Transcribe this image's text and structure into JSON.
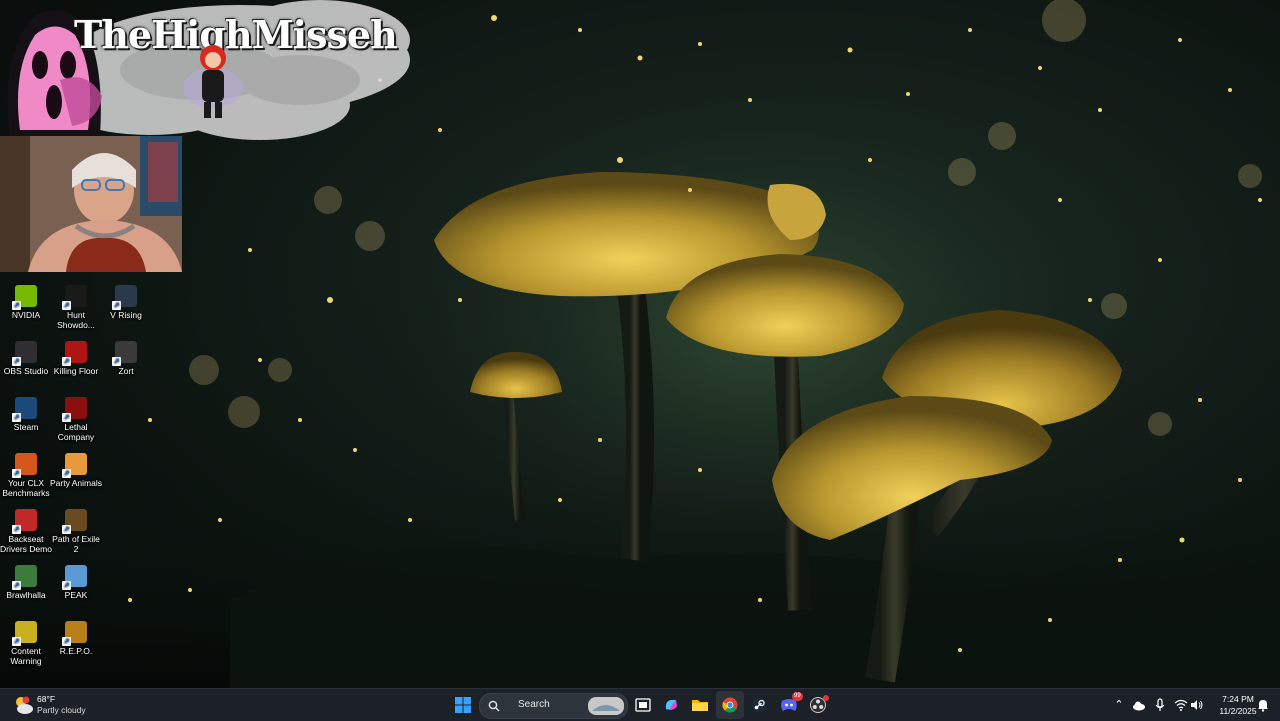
{
  "overlay": {
    "streamer_name": "TheHighMisseh"
  },
  "desktop_icons": [
    {
      "label": "NVIDIA",
      "icon": "nvidia-icon",
      "color": "#76b900"
    },
    {
      "label": "Hunt Showdo...",
      "icon": "hunt-showdown-icon",
      "color": "#1a1a1a"
    },
    {
      "label": "V Rising",
      "icon": "v-rising-icon",
      "color": "#2a3a4a"
    },
    {
      "label": "OBS Studio",
      "icon": "obs-studio-icon",
      "color": "#302e31"
    },
    {
      "label": "Killing Floor",
      "icon": "killing-floor-icon",
      "color": "#b01515"
    },
    {
      "label": "Zort",
      "icon": "zort-icon",
      "color": "#3a3a3a"
    },
    {
      "label": "Steam",
      "icon": "steam-icon",
      "color": "#1b4a7a"
    },
    {
      "label": "Lethal Company",
      "icon": "lethal-company-icon",
      "color": "#8a1010"
    },
    {
      "label": "Your CLX Benchmarks",
      "icon": "clx-benchmarks-icon",
      "color": "#d4561a"
    },
    {
      "label": "Party Animals",
      "icon": "party-animals-icon",
      "color": "#e79a3c"
    },
    {
      "label": "Backseat Drivers Demo",
      "icon": "backseat-drivers-icon",
      "color": "#c0282a"
    },
    {
      "label": "Path of Exile 2",
      "icon": "path-of-exile-icon",
      "color": "#6a4a20"
    },
    {
      "label": "Brawlhalla",
      "icon": "brawlhalla-icon",
      "color": "#3d7a3d"
    },
    {
      "label": "PEAK",
      "icon": "peak-icon",
      "color": "#5a9ad4"
    },
    {
      "label": "Content Warning",
      "icon": "content-warning-icon",
      "color": "#c8b020"
    },
    {
      "label": "R.E.P.O.",
      "icon": "repo-icon",
      "color": "#b8801a"
    }
  ],
  "taskbar": {
    "weather": {
      "temp": "68°F",
      "desc": "Partly cloudy",
      "icon": "partly-cloudy-icon"
    },
    "search": {
      "label": "Search"
    },
    "pinned": [
      {
        "name": "start-button",
        "icon": "windows-logo-icon"
      },
      {
        "name": "task-view",
        "icon": "task-view-icon"
      },
      {
        "name": "copilot",
        "icon": "copilot-icon"
      },
      {
        "name": "file-explorer",
        "icon": "folder-icon"
      },
      {
        "name": "chrome",
        "icon": "chrome-icon"
      },
      {
        "name": "steam",
        "icon": "steam-icon"
      },
      {
        "name": "discord",
        "icon": "discord-icon",
        "badge": "99"
      },
      {
        "name": "obs",
        "icon": "obs-icon"
      }
    ],
    "tray": {
      "time": "7:24 PM",
      "date": "11/2/2025"
    }
  },
  "colors": {
    "taskbar_bg": "#1c2127",
    "accent": "#0a84ff",
    "mushroom_cap": "#c9a83a"
  }
}
